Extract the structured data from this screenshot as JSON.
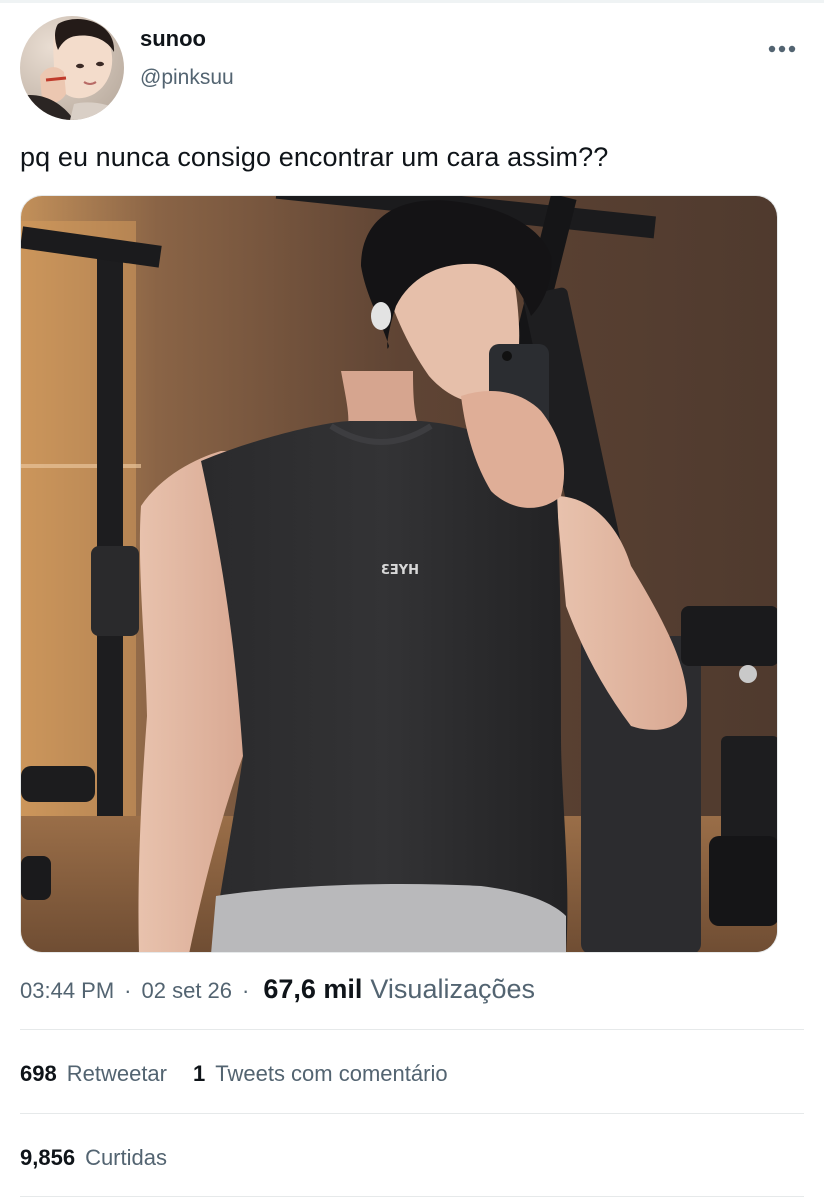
{
  "tweet": {
    "author": {
      "display_name": "sunoo",
      "handle": "@pinksuu"
    },
    "text": "pq eu nunca consigo encontrar um cara assim??",
    "media": {
      "shirt_print": "HYE3"
    },
    "meta": {
      "time": "03:44 PM",
      "separator": "·",
      "date": "02 set 26",
      "views_count": "67,6 mil",
      "views_label": "Visualizações"
    },
    "stats": {
      "retweets": {
        "count": "698",
        "label": "Retweetar"
      },
      "quotes": {
        "count": "1",
        "label": "Tweets com comentário"
      },
      "likes": {
        "count": "9,856",
        "label": "Curtidas"
      }
    }
  },
  "colors": {
    "text_primary": "#0f1419",
    "text_secondary": "#536471",
    "divider": "#e6e9ea"
  },
  "icons": {
    "more": "more-horizontal-icon"
  }
}
